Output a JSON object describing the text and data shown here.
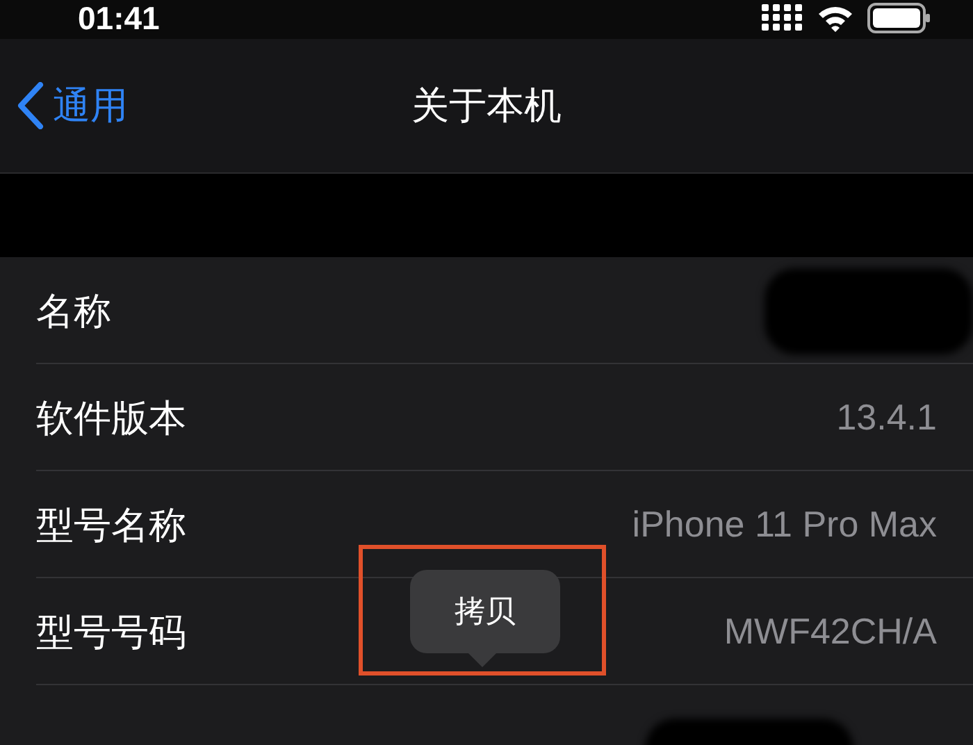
{
  "status_bar": {
    "time": "01:41"
  },
  "nav": {
    "back_label": "通用",
    "title": "关于本机"
  },
  "rows": [
    {
      "label": "名称",
      "redacted": true
    },
    {
      "label": "软件版本",
      "value": "13.4.1"
    },
    {
      "label": "型号名称",
      "value": "iPhone 11 Pro Max"
    },
    {
      "label": "型号号码",
      "value": "MWF42CH/A"
    },
    {
      "redacted": true
    }
  ],
  "copy_popup": {
    "label": "拷贝"
  }
}
